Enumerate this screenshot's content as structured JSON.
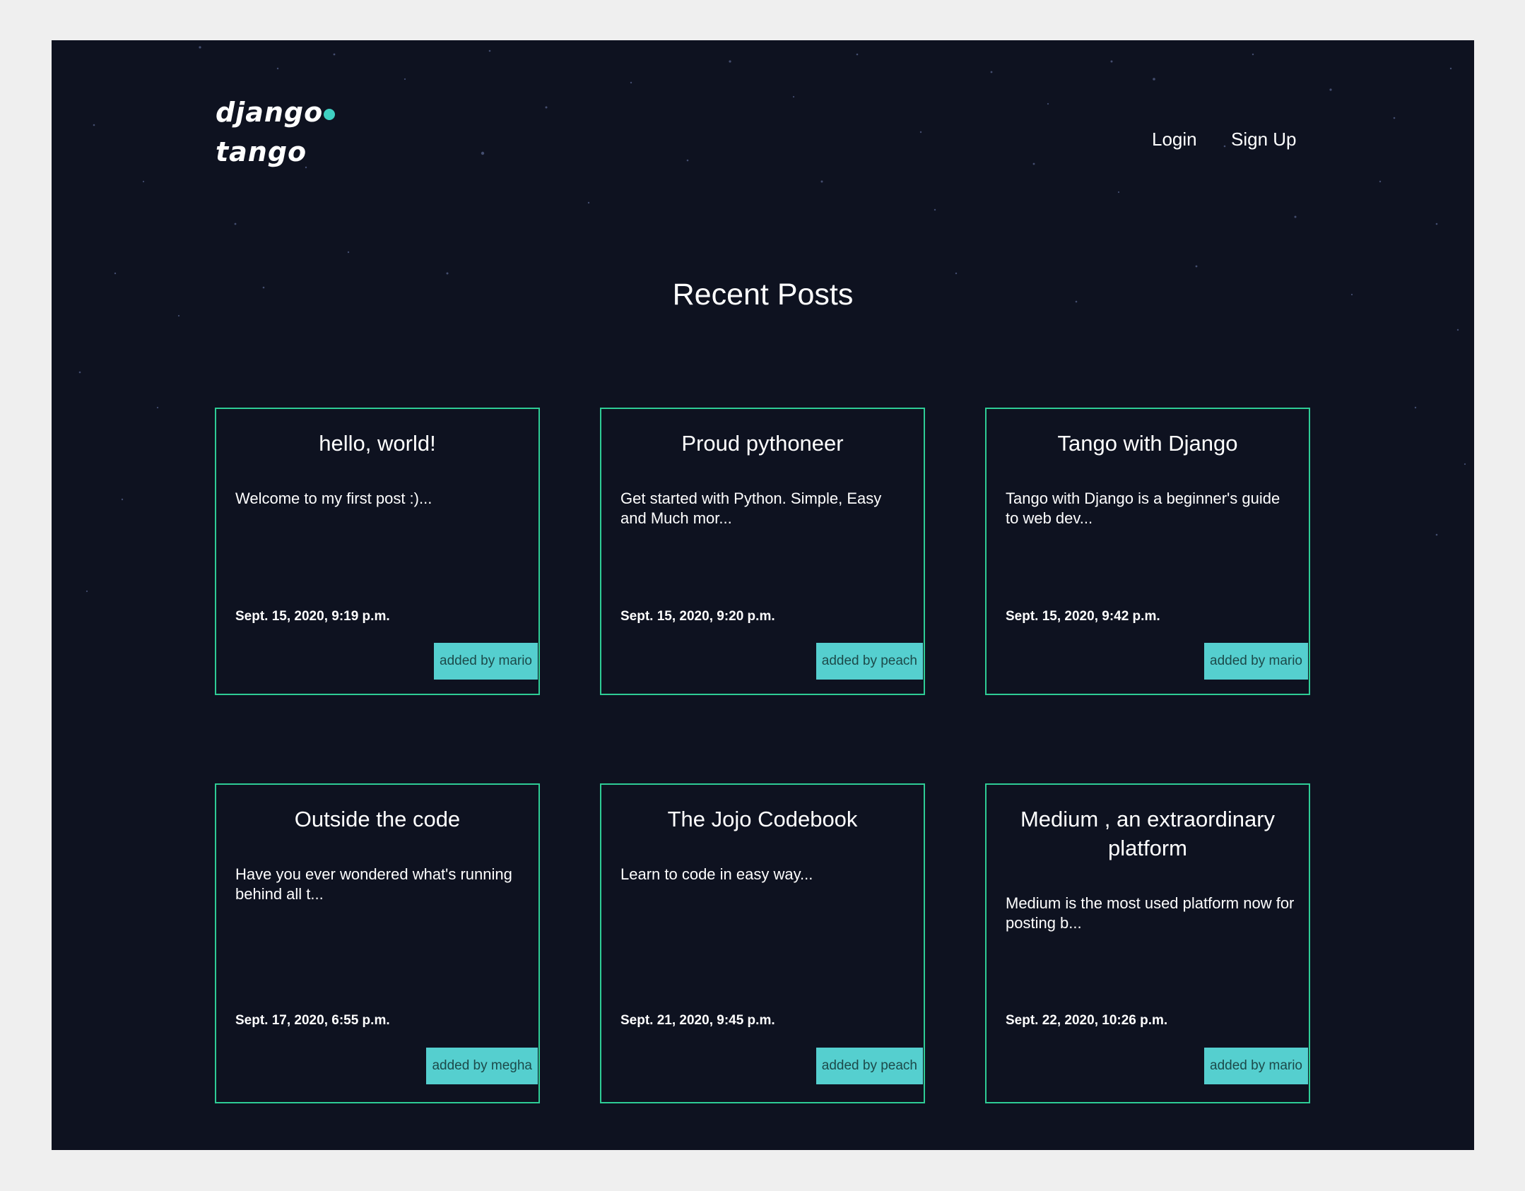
{
  "header": {
    "logo_text_left": "django",
    "logo_text_right": "tango",
    "nav": {
      "login": "Login",
      "signup": "Sign Up"
    }
  },
  "main": {
    "title": "Recent Posts",
    "posts": [
      {
        "title": "hello, world!",
        "snippet": "Welcome to my first post :)...",
        "date": "Sept. 15, 2020, 9:19 p.m.",
        "author": "added by mario"
      },
      {
        "title": "Proud pythoneer",
        "snippet": "Get started with Python. Simple, Easy and Much mor...",
        "date": "Sept. 15, 2020, 9:20 p.m.",
        "author": "added by peach"
      },
      {
        "title": "Tango with Django",
        "snippet": "Tango with Django is a beginner's guide to web dev...",
        "date": "Sept. 15, 2020, 9:42 p.m.",
        "author": "added by mario"
      },
      {
        "title": "Outside the code",
        "snippet": "Have you ever wondered what's running behind all t...",
        "date": "Sept. 17, 2020, 6:55 p.m.",
        "author": "added by megha"
      },
      {
        "title": "The Jojo Codebook",
        "snippet": "Learn to code in easy way...",
        "date": "Sept. 21, 2020, 9:45 p.m.",
        "author": "added by peach"
      },
      {
        "title": "Medium , an extraordinary platform",
        "snippet": "Medium is the most used platform now for posting b...",
        "date": "Sept. 22, 2020, 10:26 p.m.",
        "author": "added by mario"
      }
    ]
  },
  "colors": {
    "background": "#0e1220",
    "card_border": "#2ecc95",
    "author_badge": "#55cfcf",
    "logo_accent": "#3fd0c2"
  }
}
